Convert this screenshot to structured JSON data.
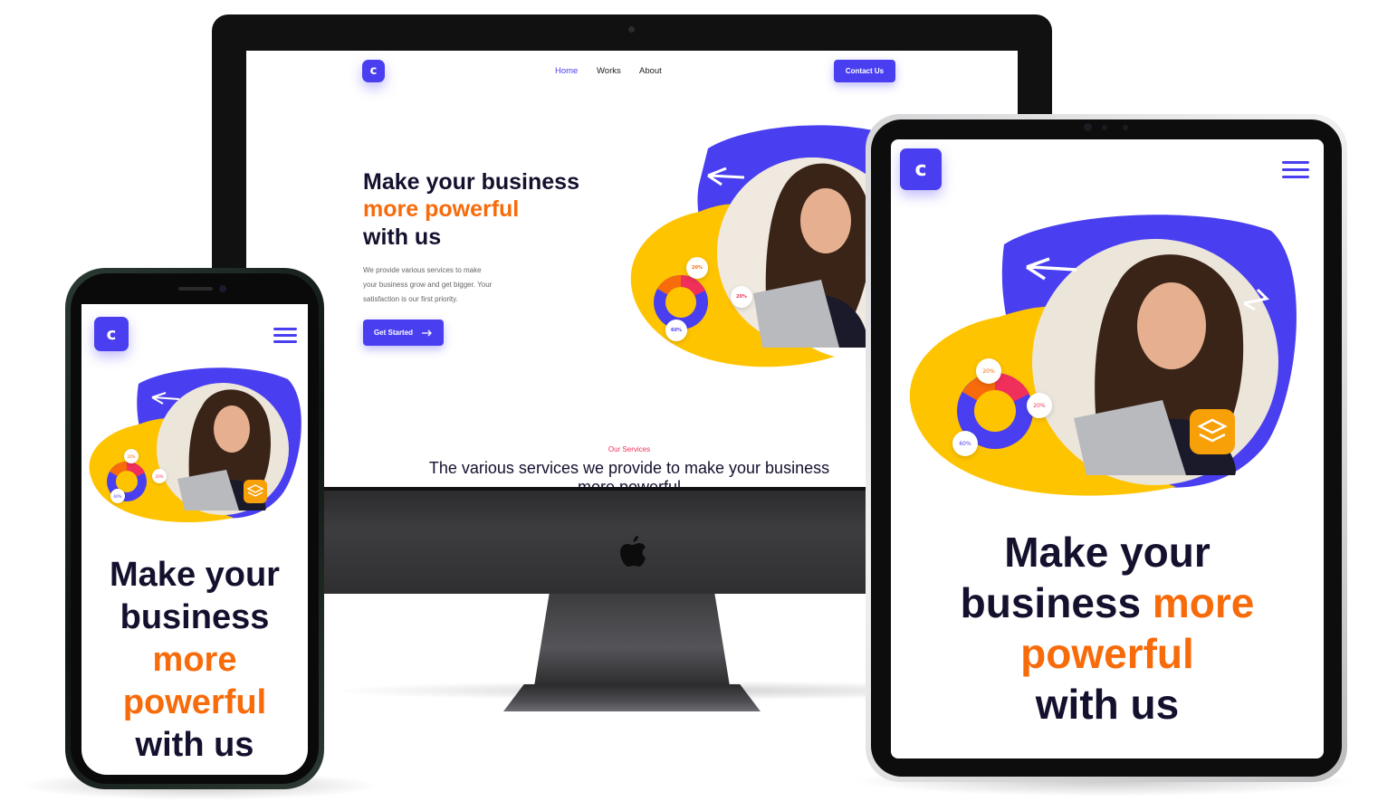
{
  "colors": {
    "brand": "#4a3ff0",
    "accent": "#f76b0a",
    "heading": "#14112e",
    "yellow": "#ffc400",
    "pink": "#f0305a"
  },
  "icons": {
    "logo": "c-letter-icon",
    "menu": "hamburger-menu-icon",
    "cta_arrow": "arrow-right-icon",
    "layers": "layers-icon",
    "apple": "apple-logo-icon"
  },
  "desktop": {
    "logo_letter": "c",
    "nav": {
      "home": "Home",
      "works": "Works",
      "about": "About"
    },
    "contact_button": "Contact Us",
    "hero": {
      "line1": "Make your business",
      "line2": "more powerful",
      "line3": "with us",
      "paragraph_l1": "We provide various services to make",
      "paragraph_l2": "your business grow and get bigger. Your",
      "paragraph_l3": "satisfaction is our first priority.",
      "cta": "Get Started"
    },
    "donut": {
      "badge_top": "20%",
      "badge_right": "20%",
      "badge_bottom": "60%"
    },
    "services": {
      "eyebrow": "Our Services",
      "title": "The various services we provide to make your business",
      "title_l2": "more powerful"
    }
  },
  "mobile": {
    "logo_letter": "c",
    "hero": {
      "l1": "Make your",
      "l2": "business",
      "l3": "more",
      "l4": "powerful",
      "l5": "with us"
    },
    "donut": {
      "badge_top": "20%",
      "badge_right": "20%",
      "badge_bottom": "60%"
    }
  },
  "tablet": {
    "logo_letter": "c",
    "hero": {
      "l1": "Make your",
      "l2_dark": "business",
      "l2_accent": "more",
      "l3": "powerful",
      "l4": "with us"
    },
    "donut": {
      "badge_top": "20%",
      "badge_right": "20%",
      "badge_bottom": "60%"
    }
  }
}
